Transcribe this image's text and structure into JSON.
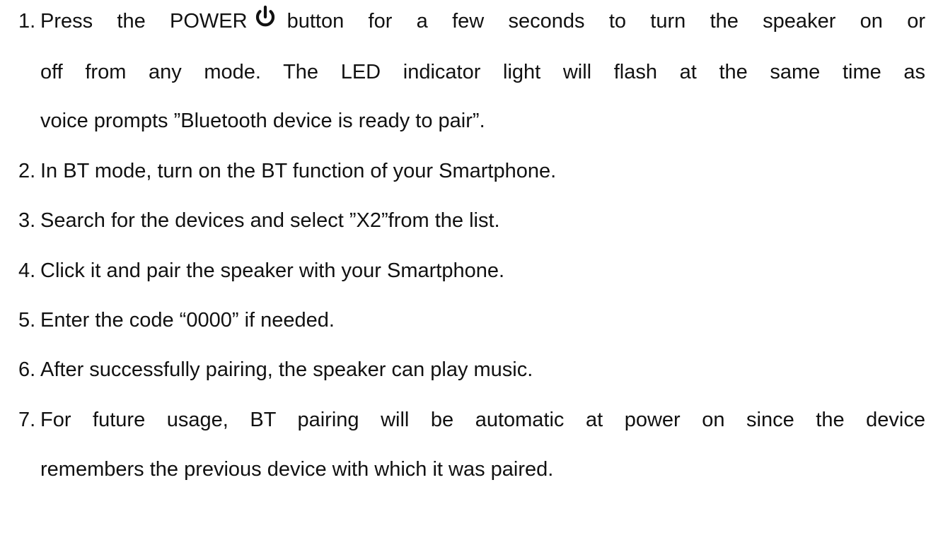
{
  "steps": [
    {
      "number": "1.",
      "text_before_icon": "Press the POWER",
      "icon": "power-icon",
      "text_after_icon": "button for a few seconds to turn the speaker on or",
      "line2": "off from any mode. The LED indicator light will flash at the same time as",
      "line3": "voice prompts ”Bluetooth device is ready to pair”."
    },
    {
      "number": "2.",
      "text": "In BT mode, turn on the BT function of your Smartphone."
    },
    {
      "number": "3.",
      "text": "Search for the devices and select ”X2”from the list."
    },
    {
      "number": "4.",
      "text": "Click it and pair the speaker with your Smartphone."
    },
    {
      "number": "5.",
      "text": "Enter the code “0000” if needed."
    },
    {
      "number": "6.",
      "text": "After successfully pairing, the speaker can play music."
    },
    {
      "number": "7.",
      "text": "For future usage, BT pairing will be automatic at power on since the device",
      "line2": "remembers the previous device with which it was paired."
    }
  ]
}
